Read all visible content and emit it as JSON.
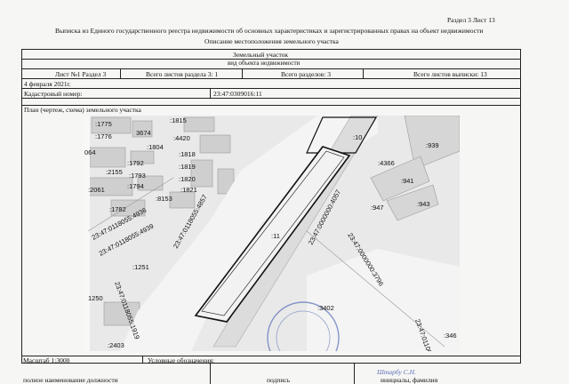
{
  "header": {
    "section_sheet": "Раздел 3   Лист 13",
    "title": "Выписка из Единого государственного реестра недвижимости об основных характеристиках и зарегистрированных правах на объект недвижимости",
    "subtitle": "Описание местоположения земельного участка"
  },
  "table": {
    "object_name": "Земельный участок",
    "object_type": "вид объекта недвижимости",
    "sheet_section": "Лист №1   Раздел 3",
    "section_sheets_total": "Всего листов раздела 3: 1",
    "sections_total": "Всего разделов: 3",
    "extract_sheets_total": "Всего листов выписки: 13",
    "date": "4 февраля 2021г.",
    "cadastral_label": "Кадастровый номер:",
    "cadastral_value": "23:47:0309016:11",
    "plan_caption": "План (чертеж, схема) земельного участка",
    "scale": "Масштаб 1:3000",
    "legend": "Условные обозначения:",
    "footer_position": "полное наименование должности",
    "footer_signature": "подпись",
    "footer_initials": "инициалы, фамилия",
    "signature_text": "Штарбу С.Н."
  },
  "map": {
    "labels": [
      ":1775",
      ":1776",
      "3674",
      ":1815",
      ":4420",
      ":1804",
      "064",
      ":1792",
      ":1818",
      ":2155",
      ":1793",
      ":1819",
      ":1820",
      ":2061",
      ":1794",
      ":8153",
      ":1821",
      ":1782",
      ":10",
      ":939",
      ":4366",
      ":941",
      ":947",
      ":943",
      ":11",
      ":1251",
      "1250",
      ":2403",
      ":3402",
      ":346"
    ],
    "road_labels": [
      "23:47:0118055:4857",
      "23:47:0118055:4936",
      "23:47:0118055:4939",
      "23:47:0118055:1919",
      "23:47:0000000:4057",
      "23:47:0000000:3796",
      "23:47:0110023:310"
    ]
  }
}
